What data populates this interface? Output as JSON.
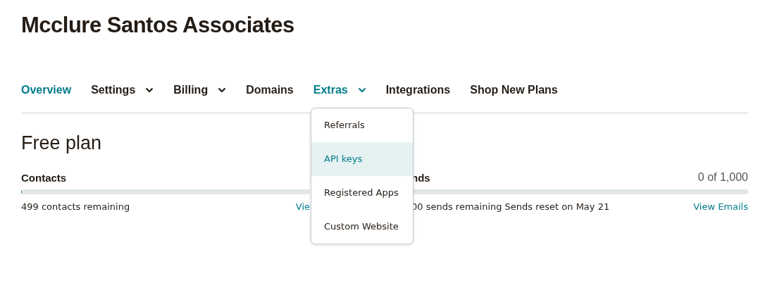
{
  "title": "Mcclure Santos Associates",
  "tabs": [
    {
      "label": "Overview",
      "selected": true,
      "dropdown": false
    },
    {
      "label": "Settings",
      "selected": false,
      "dropdown": true
    },
    {
      "label": "Billing",
      "selected": false,
      "dropdown": true
    },
    {
      "label": "Domains",
      "selected": false,
      "dropdown": false
    },
    {
      "label": "Extras",
      "selected": true,
      "dropdown": true
    },
    {
      "label": "Integrations",
      "selected": false,
      "dropdown": false
    },
    {
      "label": "Shop New Plans",
      "selected": false,
      "dropdown": false
    }
  ],
  "plan_heading": "Free plan",
  "usage": [
    {
      "heading": "Contacts",
      "level": 0.003,
      "remaining": "499 contacts remaining",
      "link": "Vie"
    },
    {
      "heading": "nds",
      "count": "0 of 1,000",
      "level": 0,
      "remaining": "00 sends remaining Sends reset on May 21",
      "link": "View Emails"
    }
  ],
  "dropdown_menu": [
    {
      "label": "Referrals",
      "selected": false
    },
    {
      "label": "API keys",
      "selected": true
    },
    {
      "label": "Registered Apps",
      "selected": false
    },
    {
      "label": "Custom Website",
      "selected": false
    }
  ]
}
